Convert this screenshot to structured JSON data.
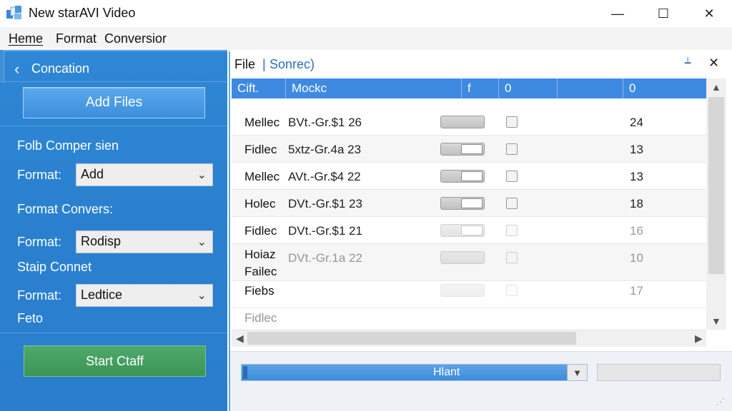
{
  "window": {
    "title": "New starAVI Video",
    "minimize": "—",
    "maximize": "☐",
    "close": "✕"
  },
  "menu": {
    "items": [
      "Heme",
      "Format",
      "Conversior"
    ]
  },
  "sidebar": {
    "back_label": "Concation",
    "add_files": "Add Files",
    "section1": "Folb Comper sien",
    "format_label1": "Format:",
    "format_value1": "Add",
    "section2": "Format Convers:",
    "format_label2": "Format:",
    "format_value2": "Rodisp",
    "section3": "Staip Connet",
    "format_label3": "Format:",
    "format_value3": "Ledtice",
    "footer_label": "Feto",
    "start_button": "Start Ctaff"
  },
  "panel": {
    "file_label": "File",
    "separator": "|",
    "source_label": "Sonrec)",
    "columns": [
      "Cift.",
      "Mockc",
      "f",
      "0",
      "",
      "0"
    ],
    "rows": [
      {
        "name": "Mellec",
        "desc": "BVt.-Gr.$1 26",
        "num": "24",
        "bar": "plain"
      },
      {
        "name": "Fidlec",
        "desc": "5xtz-Gr.4a 23",
        "num": "13",
        "bar": "knob"
      },
      {
        "name": "Mellec",
        "desc": "AVt.-Gr.$4 22",
        "num": "13",
        "bar": "knob"
      },
      {
        "name": "Holec",
        "desc": "DVt.-Gr.$1 23",
        "num": "18",
        "bar": "knob"
      },
      {
        "name": "Fidlec",
        "desc": "DVt.-Gr.$1 21",
        "num": "16",
        "bar": "knob"
      },
      {
        "name": "Hoiaz",
        "name2": "Failec",
        "desc": "DVt.-Gr.1a 22",
        "num": "10",
        "bar": "plain"
      },
      {
        "name": "Fiebs",
        "desc": "",
        "num": "17",
        "bar": "plain"
      },
      {
        "name": "Fidlec",
        "desc": "",
        "num": "",
        "bar": "none"
      }
    ]
  },
  "bottom": {
    "select_value": "Hlant"
  },
  "colors": {
    "sidebar_blue": "#2e87d4",
    "header_blue": "#3d8ae0",
    "start_green": "#4fa96a"
  }
}
